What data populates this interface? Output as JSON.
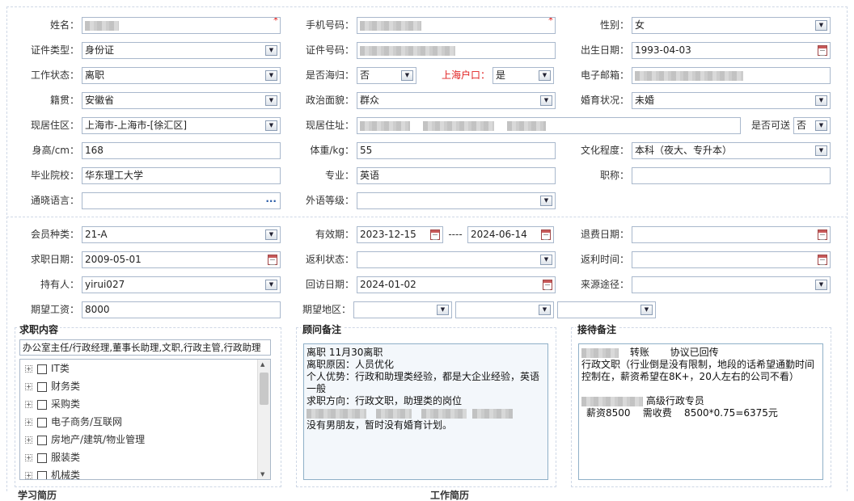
{
  "basic": {
    "name_label": "姓名：",
    "phone_label": "手机号码：",
    "gender_label": "性别：",
    "gender": "女",
    "idtype_label": "证件类型：",
    "idtype": "身份证",
    "idno_label": "证件号码：",
    "birth_label": "出生日期：",
    "birth": "1993-04-03",
    "work_label": "工作状态：",
    "work": "离职",
    "overseas_label": "是否海归：",
    "overseas": "否",
    "hukou_label": "上海户口：",
    "hukou": "是",
    "email_label": "电子邮箱：",
    "native_label": "籍贯：",
    "native": "安徽省",
    "political_label": "政治面貌：",
    "political": "群众",
    "marital_label": "婚育状况：",
    "marital": "未婚",
    "area_label": "现居住区：",
    "area": "上海市-上海市-[徐汇区]",
    "addr_label": "现居住址：",
    "reachable_label": "是否可送",
    "reachable": "否",
    "height_label": "身高/cm：",
    "height": "168",
    "weight_label": "体重/kg：",
    "weight": "55",
    "edu_label": "文化程度：",
    "edu": "本科（夜大、专升本）",
    "school_label": "毕业院校：",
    "school": "华东理工大学",
    "major_label": "专业：",
    "major": "英语",
    "title_label": "职称：",
    "title": "",
    "lang_label": "通晓语言：",
    "lang": "",
    "foreign_label": "外语等级：",
    "foreign": ""
  },
  "member": {
    "type_label": "会员种类：",
    "type": "21-A",
    "valid_label": "有效期：",
    "valid_from": "2023-12-15",
    "valid_sep": "----",
    "valid_to": "2024-06-14",
    "refund_label": "退费日期：",
    "refund": "",
    "job_date_label": "求职日期：",
    "job_date": "2009-05-01",
    "rebate_state_label": "返利状态：",
    "rebate_state": "",
    "rebate_time_label": "返利时间：",
    "rebate_time": "",
    "holder_label": "持有人：",
    "holder": "yirui027",
    "visit_label": "回访日期：",
    "visit": "2024-01-02",
    "source_label": "来源途径：",
    "source": "",
    "salary_label": "期望工资：",
    "salary": "8000",
    "region_label": "期望地区："
  },
  "panels": {
    "job_title": "求职内容",
    "job_text": "办公室主任/行政经理,董事长助理,文职,行政主管,行政助理",
    "categories": [
      "IT类",
      "财务类",
      "采购类",
      "电子商务/互联网",
      "房地产/建筑/物业管理",
      "服装类",
      "机械类"
    ],
    "advisor_title": "顾问备注",
    "advisor_lines": [
      "离职 11月30离职",
      "离职原因：人员优化",
      "个人优势：行政和助理类经验，都是大企业经验，英语",
      "一般",
      "求职方向：行政文职，助理类的岗位",
      "没有男朋友，暂时没有婚育计划。"
    ],
    "reception_title": "接待备注",
    "reception_line1_a": "转账",
    "reception_line1_b": "协议已回传",
    "reception_lines": [
      "行政文职（行业倒是没有限制，地段的话希望通勤时间",
      "控制在，薪资希望在8K+，20人左右的公司不看）"
    ],
    "reception_pos": "高级行政专员",
    "reception_fee": "薪资8500    需收费    8500*0.75=6375元"
  },
  "bottom": {
    "left": "学习简历",
    "right": "工作简历"
  },
  "colors": {
    "required": "#e02020",
    "border": "#a9b8cc",
    "note_bg": "#f3f7fb"
  }
}
